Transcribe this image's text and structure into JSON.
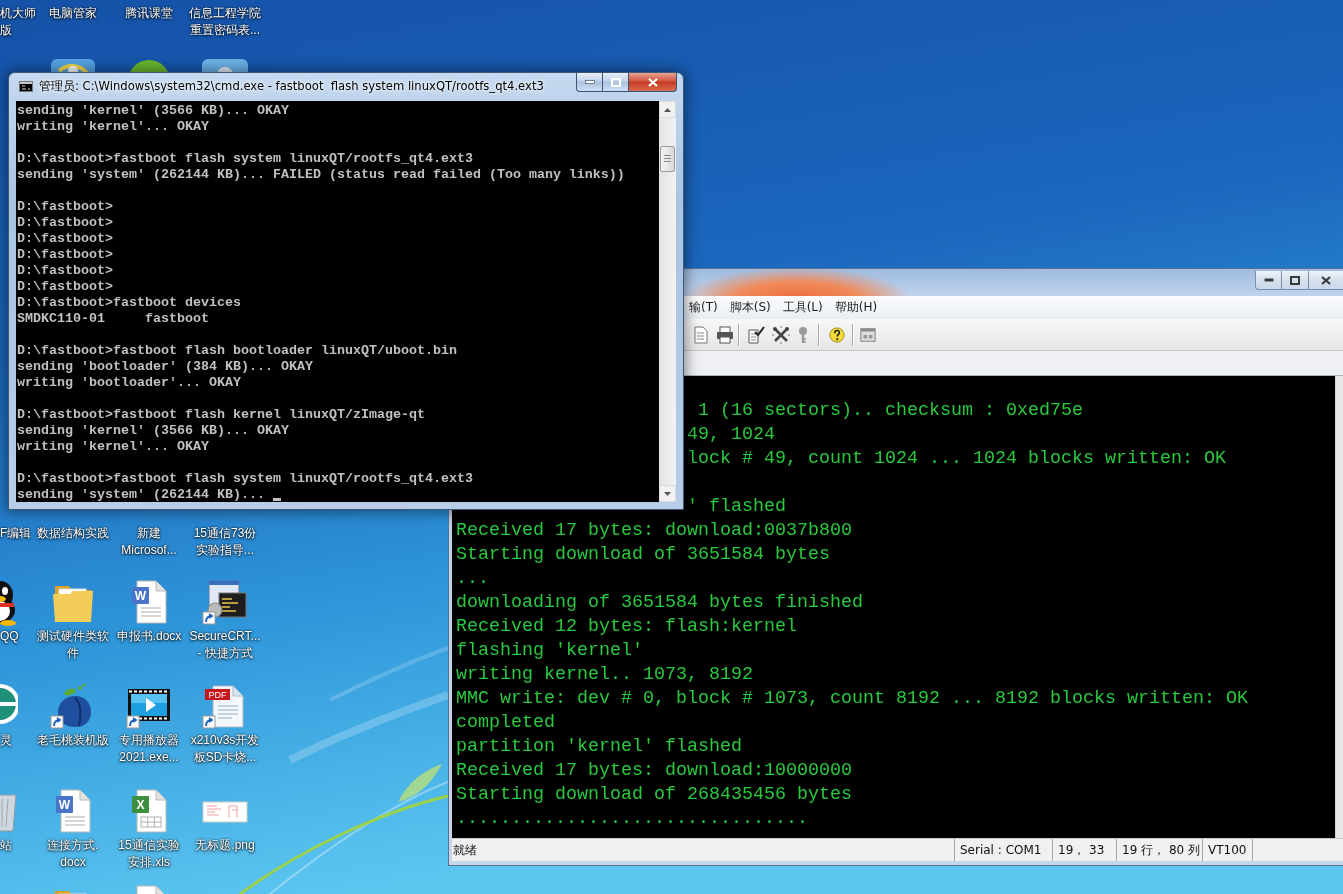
{
  "desktop": {
    "rows": [
      [
        {
          "label": "机大师版"
        },
        {
          "label": "电脑管家"
        },
        {
          "label": "腾讯课堂"
        },
        {
          "label": "信息工程学院重置密码表..."
        }
      ],
      [
        {
          "kind": "tile"
        },
        {
          "kind": "ball"
        },
        {
          "kind": "tile-light"
        }
      ],
      [
        {
          "label": "F编辑"
        },
        {
          "label": "数据结构实践"
        },
        {
          "label": "新建\nMicrosof..."
        },
        {
          "label": "15通信73份实验指导..."
        }
      ],
      [
        {
          "kind": "penguin",
          "label": "QQ"
        },
        {
          "kind": "folder",
          "label": "测试硬件类软件"
        },
        {
          "kind": "word",
          "badge": "W",
          "label": "申报书.docx"
        },
        {
          "kind": "terminal-app",
          "label": "SecureCRT...\n- 快捷方式"
        }
      ],
      [
        {
          "kind": "ring",
          "label": "灵"
        },
        {
          "kind": "peach",
          "label": "老毛桃装机版"
        },
        {
          "kind": "video",
          "label": "专用播放器\n2021.exe..."
        },
        {
          "kind": "pdf",
          "badge": "PDF",
          "label": "x210v3s开发板SD卡烧..."
        }
      ],
      [
        {
          "kind": "recycle",
          "label": "站"
        },
        {
          "kind": "word",
          "badge": "W",
          "label": "连接方式.\ndocx"
        },
        {
          "kind": "excel",
          "badge": "X",
          "label": "15通信实验安排.xls"
        },
        {
          "kind": "image",
          "label": "无标题.png"
        }
      ],
      [
        {
          "kind": "folder"
        },
        {
          "kind": "document"
        }
      ]
    ]
  },
  "terminal_window": {
    "active": false,
    "menu": [
      "输(T)",
      "脚本(S)",
      "工具(L)",
      "帮助(H)"
    ],
    "lines": [
      "1 (16 sectors).. checksum : 0xed75e",
      "49, 1024",
      "lock # 49, count 1024 ... 1024 blocks written: OK",
      "' flashed",
      "Received 17 bytes: download:0037b800",
      "Starting download of 3651584 bytes",
      "...",
      "downloading of 3651584 bytes finished",
      "Received 12 bytes: flash:kernel",
      "flashing 'kernel'",
      "writing kernel.. 1073, 8192",
      "MMC write: dev # 0, block # 1073, count 8192 ... 8192 blocks written: OK",
      "completed",
      "partition 'kernel' flashed",
      "Received 17 bytes: download:10000000",
      "Starting download of 268435456 bytes",
      "................................"
    ],
    "status_bar": {
      "message": "就绪",
      "cells": [
        "Serial : COM1",
        "19， 33",
        "19 行， 80 列",
        "VT100"
      ]
    }
  },
  "console_window": {
    "active": true,
    "title": "管理员: C:\\Windows\\system32\\cmd.exe - fastboot  flash system linuxQT/rootfs_qt4.ext3",
    "cursor": true,
    "blocks": [
      [
        "sending 'kernel' (3566 KB)... OKAY",
        "writing 'kernel'... OKAY"
      ],
      [
        "D:\\fastboot>fastboot flash system linuxQT/rootfs_qt4.ext3",
        "sending 'system' (262144 KB)... FAILED (status read failed (Too many links))"
      ],
      [
        "D:\\fastboot>",
        "D:\\fastboot>",
        "D:\\fastboot>",
        "D:\\fastboot>",
        "D:\\fastboot>",
        "D:\\fastboot>",
        "D:\\fastboot>fastboot devices",
        "SMDKC110-01     fastboot"
      ],
      [
        "D:\\fastboot>fastboot flash bootloader linuxQT/uboot.bin",
        "sending 'bootloader' (384 KB)... OKAY",
        "writing 'bootloader'... OKAY"
      ],
      [
        "D:\\fastboot>fastboot flash kernel linuxQT/zImage-qt",
        "sending 'kernel' (3566 KB)... OKAY",
        "writing 'kernel'... OKAY"
      ],
      [
        "D:\\fastboot>fastboot flash system linuxQT/rootfs_qt4.ext3",
        "sending 'system' (262144 KB)..."
      ]
    ]
  }
}
